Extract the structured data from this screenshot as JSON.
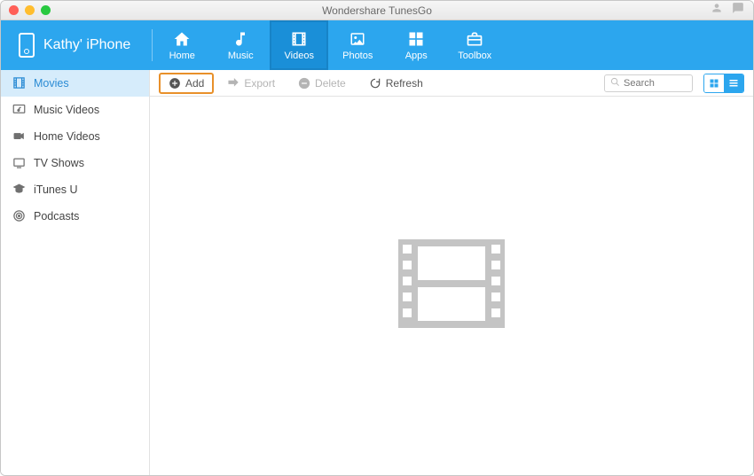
{
  "window": {
    "title": "Wondershare TunesGo"
  },
  "device": {
    "name": "Kathy' iPhone"
  },
  "nav": [
    {
      "id": "home",
      "label": "Home",
      "selected": false
    },
    {
      "id": "music",
      "label": "Music",
      "selected": false
    },
    {
      "id": "videos",
      "label": "Videos",
      "selected": true
    },
    {
      "id": "photos",
      "label": "Photos",
      "selected": false
    },
    {
      "id": "apps",
      "label": "Apps",
      "selected": false
    },
    {
      "id": "toolbox",
      "label": "Toolbox",
      "selected": false
    }
  ],
  "sidebar": [
    {
      "id": "movies",
      "label": "Movies",
      "selected": true
    },
    {
      "id": "music-videos",
      "label": "Music Videos",
      "selected": false
    },
    {
      "id": "home-videos",
      "label": "Home Videos",
      "selected": false
    },
    {
      "id": "tv-shows",
      "label": "TV Shows",
      "selected": false
    },
    {
      "id": "itunes-u",
      "label": "iTunes U",
      "selected": false
    },
    {
      "id": "podcasts",
      "label": "Podcasts",
      "selected": false
    }
  ],
  "toolbar": {
    "add": {
      "label": "Add",
      "highlighted": true,
      "enabled": true
    },
    "export": {
      "label": "Export",
      "highlighted": false,
      "enabled": false
    },
    "delete": {
      "label": "Delete",
      "highlighted": false,
      "enabled": false
    },
    "refresh": {
      "label": "Refresh",
      "highlighted": false,
      "enabled": true
    }
  },
  "search": {
    "placeholder": "Search",
    "value": ""
  },
  "view": {
    "grid_active": false,
    "list_active": true
  }
}
